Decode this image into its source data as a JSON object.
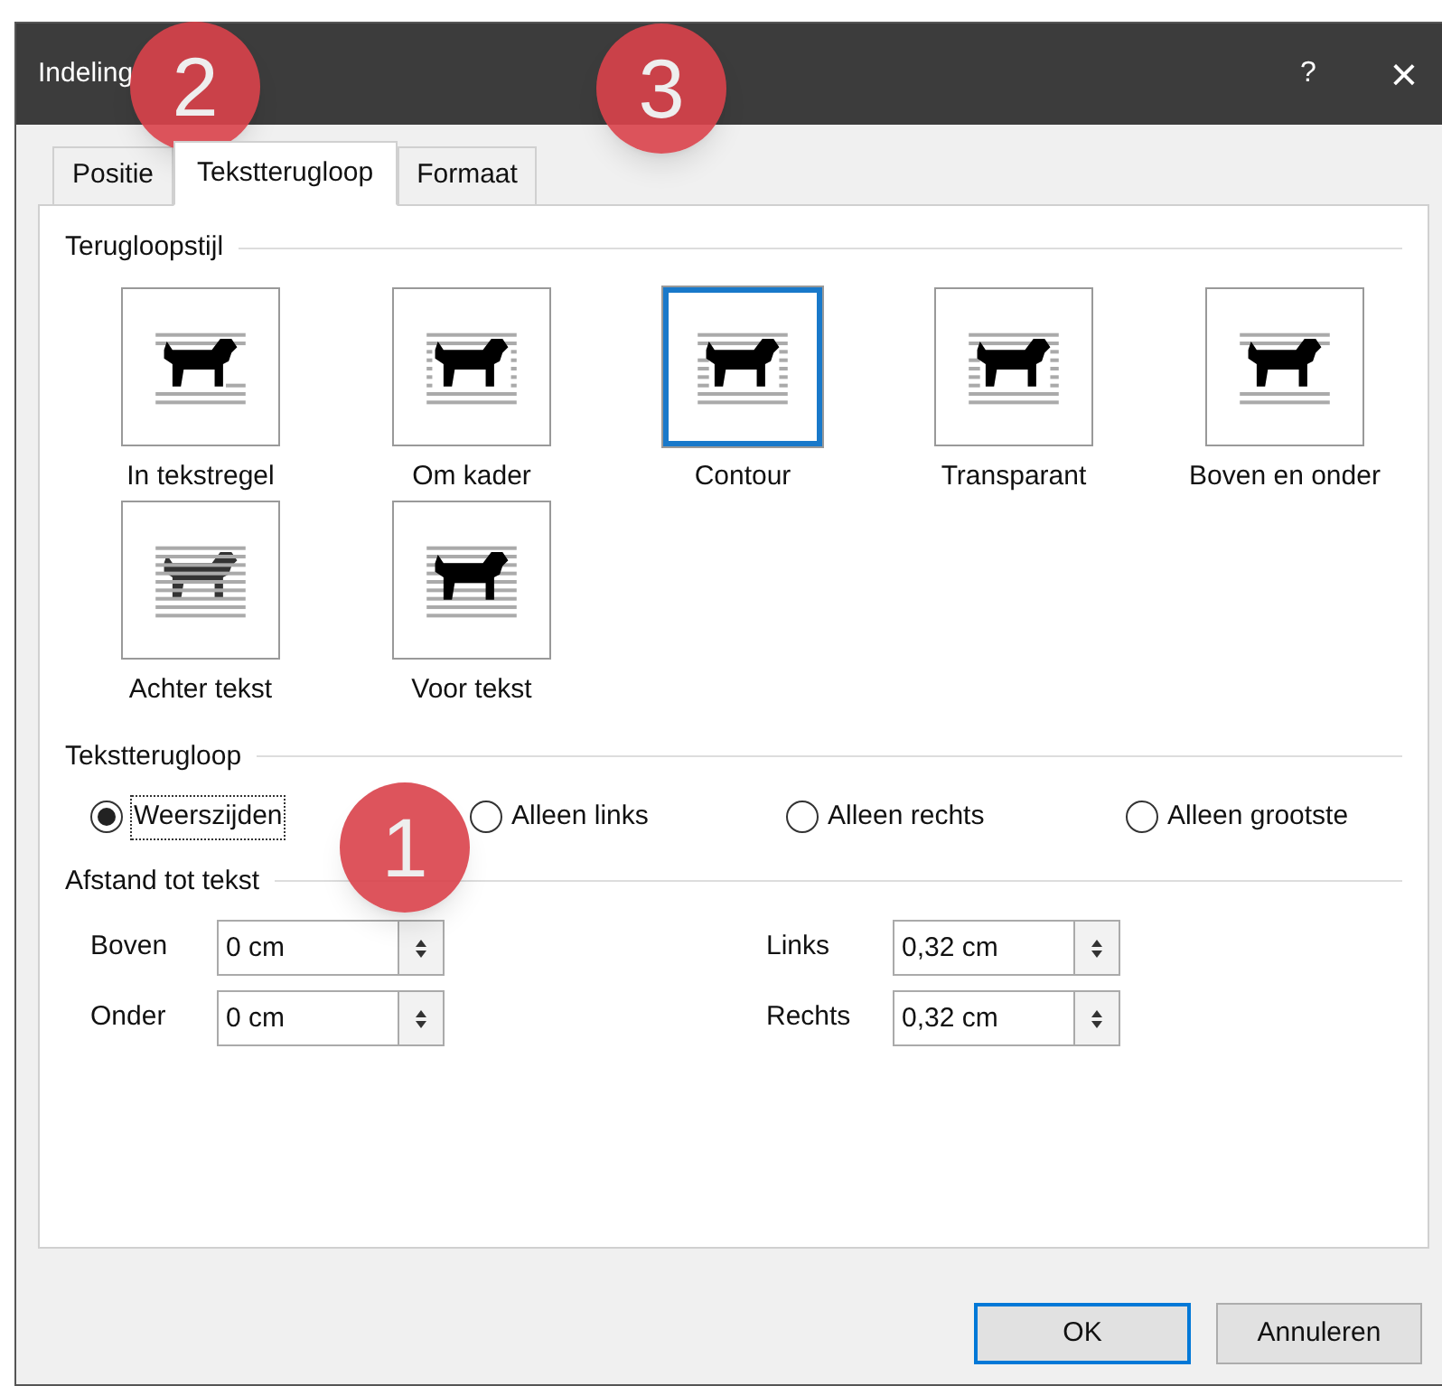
{
  "window": {
    "title": "Indeling",
    "help": "?",
    "close": "×"
  },
  "tabs": [
    {
      "label": "Positie",
      "selected": false
    },
    {
      "label": "Tekstterugloop",
      "selected": true
    },
    {
      "label": "Formaat",
      "selected": false
    }
  ],
  "wrap_style": {
    "title": "Terugloopstijl",
    "options": [
      {
        "kind": "inline",
        "label": "In tekstregel",
        "selected": false
      },
      {
        "kind": "square",
        "label": "Om kader",
        "selected": false
      },
      {
        "kind": "tight",
        "label": "Contour",
        "selected": true
      },
      {
        "kind": "through",
        "label": "Transparant",
        "selected": false
      },
      {
        "kind": "topbottom",
        "label": "Boven en onder",
        "selected": false
      },
      {
        "kind": "behind",
        "label": "Achter tekst",
        "selected": false
      },
      {
        "kind": "front",
        "label": "Voor tekst",
        "selected": false
      }
    ]
  },
  "wrap_text": {
    "title": "Tekstterugloop",
    "options": [
      {
        "label": "Weerszijden",
        "selected": true
      },
      {
        "label": "Alleen links",
        "selected": false
      },
      {
        "label": "Alleen rechts",
        "selected": false
      },
      {
        "label": "Alleen grootste",
        "selected": false
      }
    ]
  },
  "distance": {
    "title": "Afstand tot tekst",
    "fields": [
      {
        "label": "Boven",
        "value": "0 cm"
      },
      {
        "label": "Links",
        "value": "0,32 cm"
      },
      {
        "label": "Onder",
        "value": "0 cm"
      },
      {
        "label": "Rechts",
        "value": "0,32 cm"
      }
    ]
  },
  "buttons": [
    {
      "label": "OK",
      "default": true
    },
    {
      "label": "Annuleren",
      "default": false
    }
  ],
  "callouts": [
    {
      "number": "2"
    },
    {
      "number": "3"
    },
    {
      "number": "1"
    }
  ]
}
